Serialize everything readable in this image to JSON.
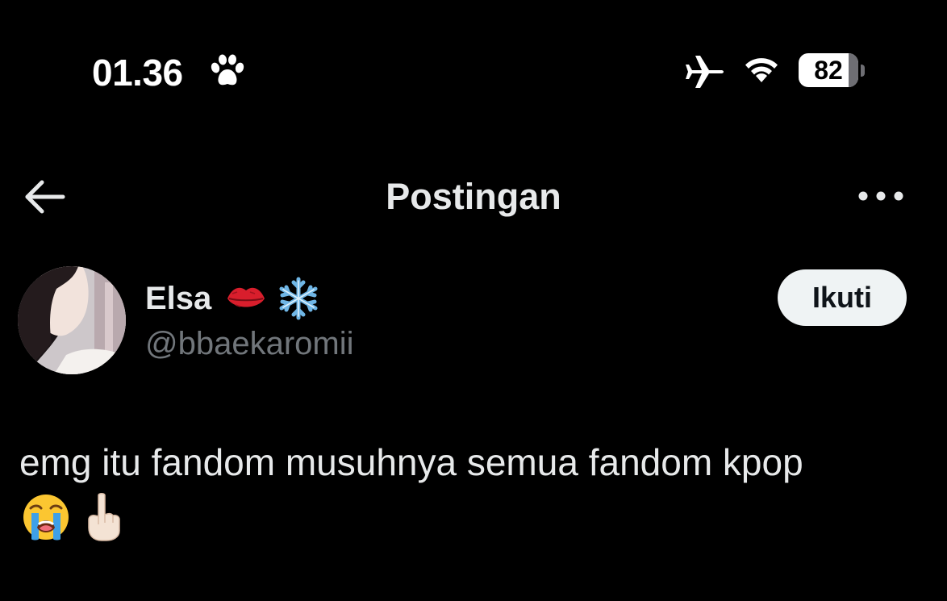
{
  "status_bar": {
    "time": "01.36",
    "battery_level": "82",
    "icons": [
      "paw-icon",
      "airplane-icon",
      "wifi-icon",
      "battery-icon"
    ]
  },
  "header": {
    "title": "Postingan",
    "back_icon": "arrow-left-icon",
    "more_icon": "more-horizontal-icon"
  },
  "post": {
    "author": {
      "name": "Elsa",
      "name_emojis": [
        "lips-icon",
        "snowflake-icon"
      ],
      "handle": "@bbaekaromii"
    },
    "follow_label": "Ikuti",
    "text": "emg itu fandom musuhnya semua fandom kpop",
    "text_emojis": [
      "loudly-crying-face-icon",
      "index-pointing-up-icon"
    ]
  },
  "colors": {
    "background": "#000000",
    "primary_text": "#e7e9ea",
    "secondary_text": "#71767b",
    "follow_button_bg": "#eff3f4"
  }
}
